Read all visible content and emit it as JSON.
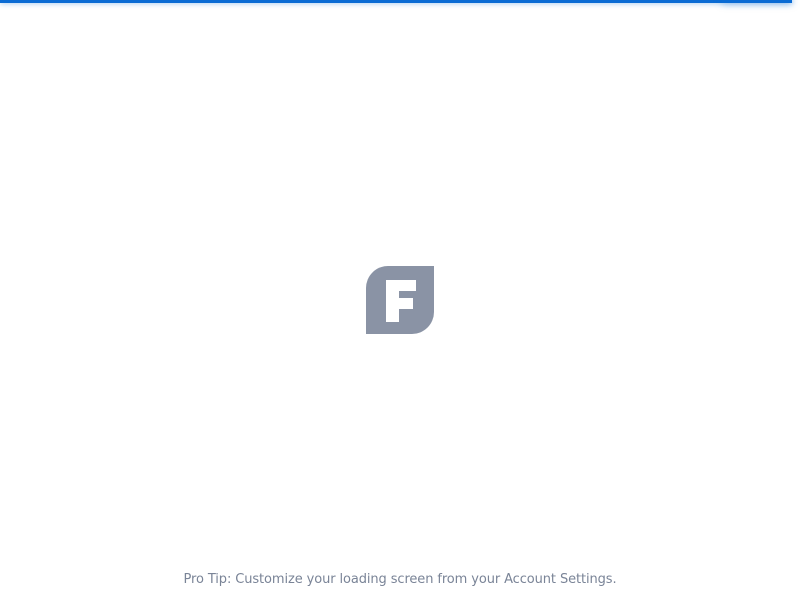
{
  "loading": {
    "progress_percent": 99,
    "accent_color": "#0a6bd4"
  },
  "logo": {
    "icon": "formstack-logo-icon",
    "color": "#8a93a5",
    "letter": "F"
  },
  "footer": {
    "pro_tip": "Pro Tip: Customize your loading screen from your Account Settings."
  }
}
